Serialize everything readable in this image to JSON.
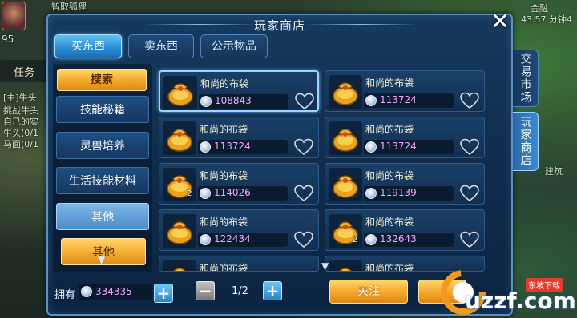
{
  "background": {
    "left_panel_label": "任务",
    "top_left_text": "智取狐狸",
    "top_right_text": "金融",
    "top_right_sub": "43.57 分钟4",
    "level": "95",
    "left_quest_lines": [
      "[主]牛头",
      "挑战牛头",
      "自己的实",
      "牛头(0/1",
      "马面(0/1"
    ],
    "right_label": "建筑"
  },
  "window": {
    "title": "玩家商店",
    "close_label": "✕"
  },
  "top_tabs": [
    "买东西",
    "卖东西",
    "公示物品"
  ],
  "side_tabs": [
    "交易市场",
    "玩家商店"
  ],
  "categories": {
    "search": "搜索",
    "items": [
      "技能秘籍",
      "灵兽培养",
      "生活技能材料",
      "其他"
    ],
    "sub_item": "其他"
  },
  "items": [
    {
      "name": "和尚的布袋",
      "price": "108843",
      "qty": ""
    },
    {
      "name": "和尚的布袋",
      "price": "113724",
      "qty": ""
    },
    {
      "name": "和尚的布袋",
      "price": "113724",
      "qty": ""
    },
    {
      "name": "和尚的布袋",
      "price": "113724",
      "qty": ""
    },
    {
      "name": "和尚的布袋",
      "price": "114026",
      "qty": "2"
    },
    {
      "name": "和尚的布袋",
      "price": "119139",
      "qty": ""
    },
    {
      "name": "和尚的布袋",
      "price": "122434",
      "qty": ""
    },
    {
      "name": "和尚的布袋",
      "price": "132643",
      "qty": "2"
    },
    {
      "name": "和尚的布袋",
      "price": "",
      "qty": ""
    },
    {
      "name": "和尚的布袋",
      "price": "",
      "qty": ""
    }
  ],
  "bottom": {
    "own_label": "拥有",
    "money": "334335",
    "page": "1/2",
    "follow_button": "关注"
  },
  "watermark": {
    "text": "uzzf.com",
    "tag": "东坡下载"
  },
  "colors": {
    "accent_blue": "#2c8fd6",
    "gold": "#f4a72b",
    "price_pink": "#f6a4ff"
  }
}
